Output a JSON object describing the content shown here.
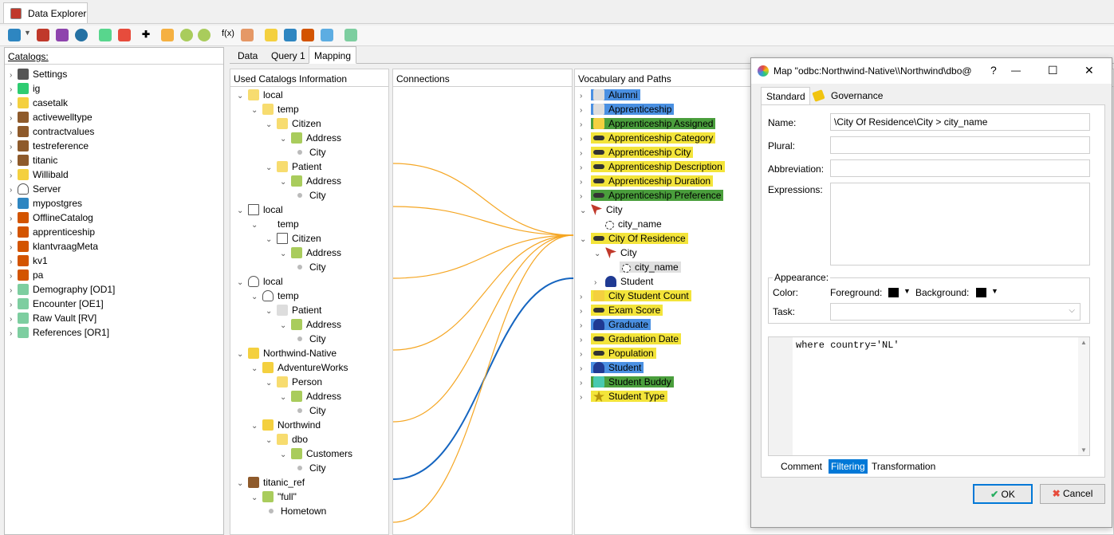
{
  "app_tab": {
    "title": "Data Explorer"
  },
  "catalogs": {
    "header": "Catalogs:",
    "items": [
      {
        "label": "Settings",
        "icon": "gear-icon"
      },
      {
        "label": "ig",
        "icon": "green-db-icon"
      },
      {
        "label": "casetalk",
        "icon": "yellow-db-icon"
      },
      {
        "label": "activewelltype",
        "icon": "books-icon"
      },
      {
        "label": "contractvalues",
        "icon": "books-icon"
      },
      {
        "label": "testreference",
        "icon": "books-icon"
      },
      {
        "label": "titanic",
        "icon": "books-icon"
      },
      {
        "label": "Willibald",
        "icon": "monitor-yellow-icon"
      },
      {
        "label": "Server",
        "icon": "cloud-icon"
      },
      {
        "label": "mypostgres",
        "icon": "monitor-blue-icon"
      },
      {
        "label": "OfflineCatalog",
        "icon": "pencil-icon"
      },
      {
        "label": "apprenticeship",
        "icon": "pencil-icon"
      },
      {
        "label": "klantvraagMeta",
        "icon": "pencil-icon"
      },
      {
        "label": "kv1",
        "icon": "pencil-icon"
      },
      {
        "label": "pa",
        "icon": "pencil-icon"
      },
      {
        "label": "Demography [OD1]",
        "icon": "robot-icon"
      },
      {
        "label": "Encounter [OE1]",
        "icon": "robot-icon"
      },
      {
        "label": "Raw Vault [RV]",
        "icon": "robot-icon"
      },
      {
        "label": "References [OR1]",
        "icon": "robot-icon"
      }
    ]
  },
  "main_tabs": [
    {
      "label": "Data"
    },
    {
      "label": "Query 1"
    },
    {
      "label": "Mapping"
    }
  ],
  "used_catalogs": {
    "header": "Used Catalogs Information",
    "rows": [
      {
        "label": "local",
        "level": 0,
        "icon": "folder-icon"
      },
      {
        "label": "temp",
        "level": 1,
        "icon": "folder-open-icon"
      },
      {
        "label": "Citizen",
        "level": 2,
        "icon": "folder-open-icon"
      },
      {
        "label": "Address",
        "level": 3,
        "icon": "table-icon"
      },
      {
        "label": "City",
        "level": 4,
        "icon": "dot-icon"
      },
      {
        "label": "Patient",
        "level": 2,
        "icon": "folder-open-icon"
      },
      {
        "label": "Address",
        "level": 3,
        "icon": "table-icon"
      },
      {
        "label": "City",
        "level": 4,
        "icon": "dot-icon"
      },
      {
        "label": "local",
        "level": 0,
        "icon": "file-icon"
      },
      {
        "label": "temp",
        "level": 1,
        "icon": "none"
      },
      {
        "label": "Citizen",
        "level": 2,
        "icon": "paragraph-icon"
      },
      {
        "label": "Address",
        "level": 3,
        "icon": "table-icon"
      },
      {
        "label": "City",
        "level": 4,
        "icon": "dot-icon"
      },
      {
        "label": "local",
        "level": 0,
        "icon": "cloud-icon"
      },
      {
        "label": "temp",
        "level": 1,
        "icon": "cloud-icon"
      },
      {
        "label": "Patient",
        "level": 2,
        "icon": "eye-icon"
      },
      {
        "label": "Address",
        "level": 3,
        "icon": "table-icon"
      },
      {
        "label": "City",
        "level": 4,
        "icon": "dot-icon"
      },
      {
        "label": "Northwind-Native",
        "level": 0,
        "icon": "monitor-yellow-icon"
      },
      {
        "label": "AdventureWorks",
        "level": 1,
        "icon": "yellow-db-icon"
      },
      {
        "label": "Person",
        "level": 2,
        "icon": "folder-open-icon"
      },
      {
        "label": "Address",
        "level": 3,
        "icon": "table-icon"
      },
      {
        "label": "City",
        "level": 4,
        "icon": "dot-icon"
      },
      {
        "label": "Northwind",
        "level": 1,
        "icon": "yellow-db-icon"
      },
      {
        "label": "dbo",
        "level": 2,
        "icon": "folder-open-icon"
      },
      {
        "label": "Customers",
        "level": 3,
        "icon": "table-icon"
      },
      {
        "label": "City",
        "level": 4,
        "icon": "dot-icon"
      },
      {
        "label": "titanic_ref",
        "level": 0,
        "icon": "books-icon"
      },
      {
        "label": "\"full\"",
        "level": 1,
        "icon": "table-icon"
      },
      {
        "label": "Hometown",
        "level": 2,
        "icon": "dot-icon"
      }
    ]
  },
  "connections": {
    "header": "Connections"
  },
  "vocabulary": {
    "header": "Vocabulary and Paths",
    "rows": [
      {
        "label": "Alumni",
        "level": 0,
        "hl": "blue",
        "icon": "eye-icon"
      },
      {
        "label": "Apprenticeship",
        "level": 0,
        "hl": "blue",
        "icon": "cube-icon"
      },
      {
        "label": "Apprenticeship Assigned",
        "level": 0,
        "hl": "green",
        "icon": "cubes-icon"
      },
      {
        "label": "Apprenticeship Category",
        "level": 0,
        "hl": "yellow",
        "icon": "dash-icon"
      },
      {
        "label": "Apprenticeship City",
        "level": 0,
        "hl": "yellow",
        "icon": "dash-icon"
      },
      {
        "label": "Apprenticeship Description",
        "level": 0,
        "hl": "yellow",
        "icon": "dash-icon"
      },
      {
        "label": "Apprenticeship Duration",
        "level": 0,
        "hl": "yellow",
        "icon": "dash-icon"
      },
      {
        "label": "Apprenticeship Preference",
        "level": 0,
        "hl": "green",
        "icon": "dash-icon"
      },
      {
        "label": "City",
        "level": 0,
        "hl": "none",
        "icon": "cursor-icon"
      },
      {
        "label": "city_name",
        "level": 1,
        "hl": "none",
        "icon": "circle-icon"
      },
      {
        "label": "City Of Residence",
        "level": 0,
        "hl": "yellow",
        "icon": "dash-icon"
      },
      {
        "label": "City",
        "level": 1,
        "hl": "none",
        "icon": "cursor-icon"
      },
      {
        "label": "city_name",
        "level": 2,
        "hl": "gray",
        "icon": "circle-icon"
      },
      {
        "label": "Student",
        "level": 1,
        "hl": "none",
        "icon": "person-icon"
      },
      {
        "label": "City Student Count",
        "level": 0,
        "hl": "yellow",
        "icon": "cubes-icon"
      },
      {
        "label": "Exam Score",
        "level": 0,
        "hl": "yellow",
        "icon": "dash-icon"
      },
      {
        "label": "Graduate",
        "level": 0,
        "hl": "blue",
        "icon": "person-icon"
      },
      {
        "label": "Graduation Date",
        "level": 0,
        "hl": "yellow",
        "icon": "dash-icon"
      },
      {
        "label": "Population",
        "level": 0,
        "hl": "yellow",
        "icon": "dash-icon"
      },
      {
        "label": "Student",
        "level": 0,
        "hl": "blue",
        "icon": "person-icon"
      },
      {
        "label": "Student Buddy",
        "level": 0,
        "hl": "green",
        "icon": "mask-icon"
      },
      {
        "label": "Student Type",
        "level": 0,
        "hl": "yellow",
        "icon": "star-icon"
      }
    ]
  },
  "dialog": {
    "title": "Map \"odbc:Northwind-Native\\\\Northwind\\dbo@ ",
    "help": "?",
    "minimize": "—",
    "maximize": "☐",
    "close": "✕",
    "tabs": [
      {
        "label": "Standard"
      },
      {
        "label": "Governance"
      }
    ],
    "name_label": "Name:",
    "name_value": "\\City Of Residence\\City > city_name",
    "plural_label": "Plural:",
    "abbrev_label": "Abbreviation:",
    "expr_label": "Expressions:",
    "appearance_label": "Appearance:",
    "color_label": "Color:",
    "fg_label": "Foreground:",
    "bg_label": "Background:",
    "task_label": "Task:",
    "code": "where country='NL'",
    "bottom_tabs": [
      {
        "label": "Comment"
      },
      {
        "label": "Filtering"
      },
      {
        "label": "Transformation"
      }
    ],
    "ok": "OK",
    "cancel": "Cancel"
  },
  "colors": {
    "accent": "#0078d7",
    "highlight_blue": "#4a90e2",
    "highlight_yellow": "#f3e43a",
    "highlight_green": "#4a9e3c",
    "connection_orange": "#f5a623",
    "connection_blue": "#1565c0"
  }
}
